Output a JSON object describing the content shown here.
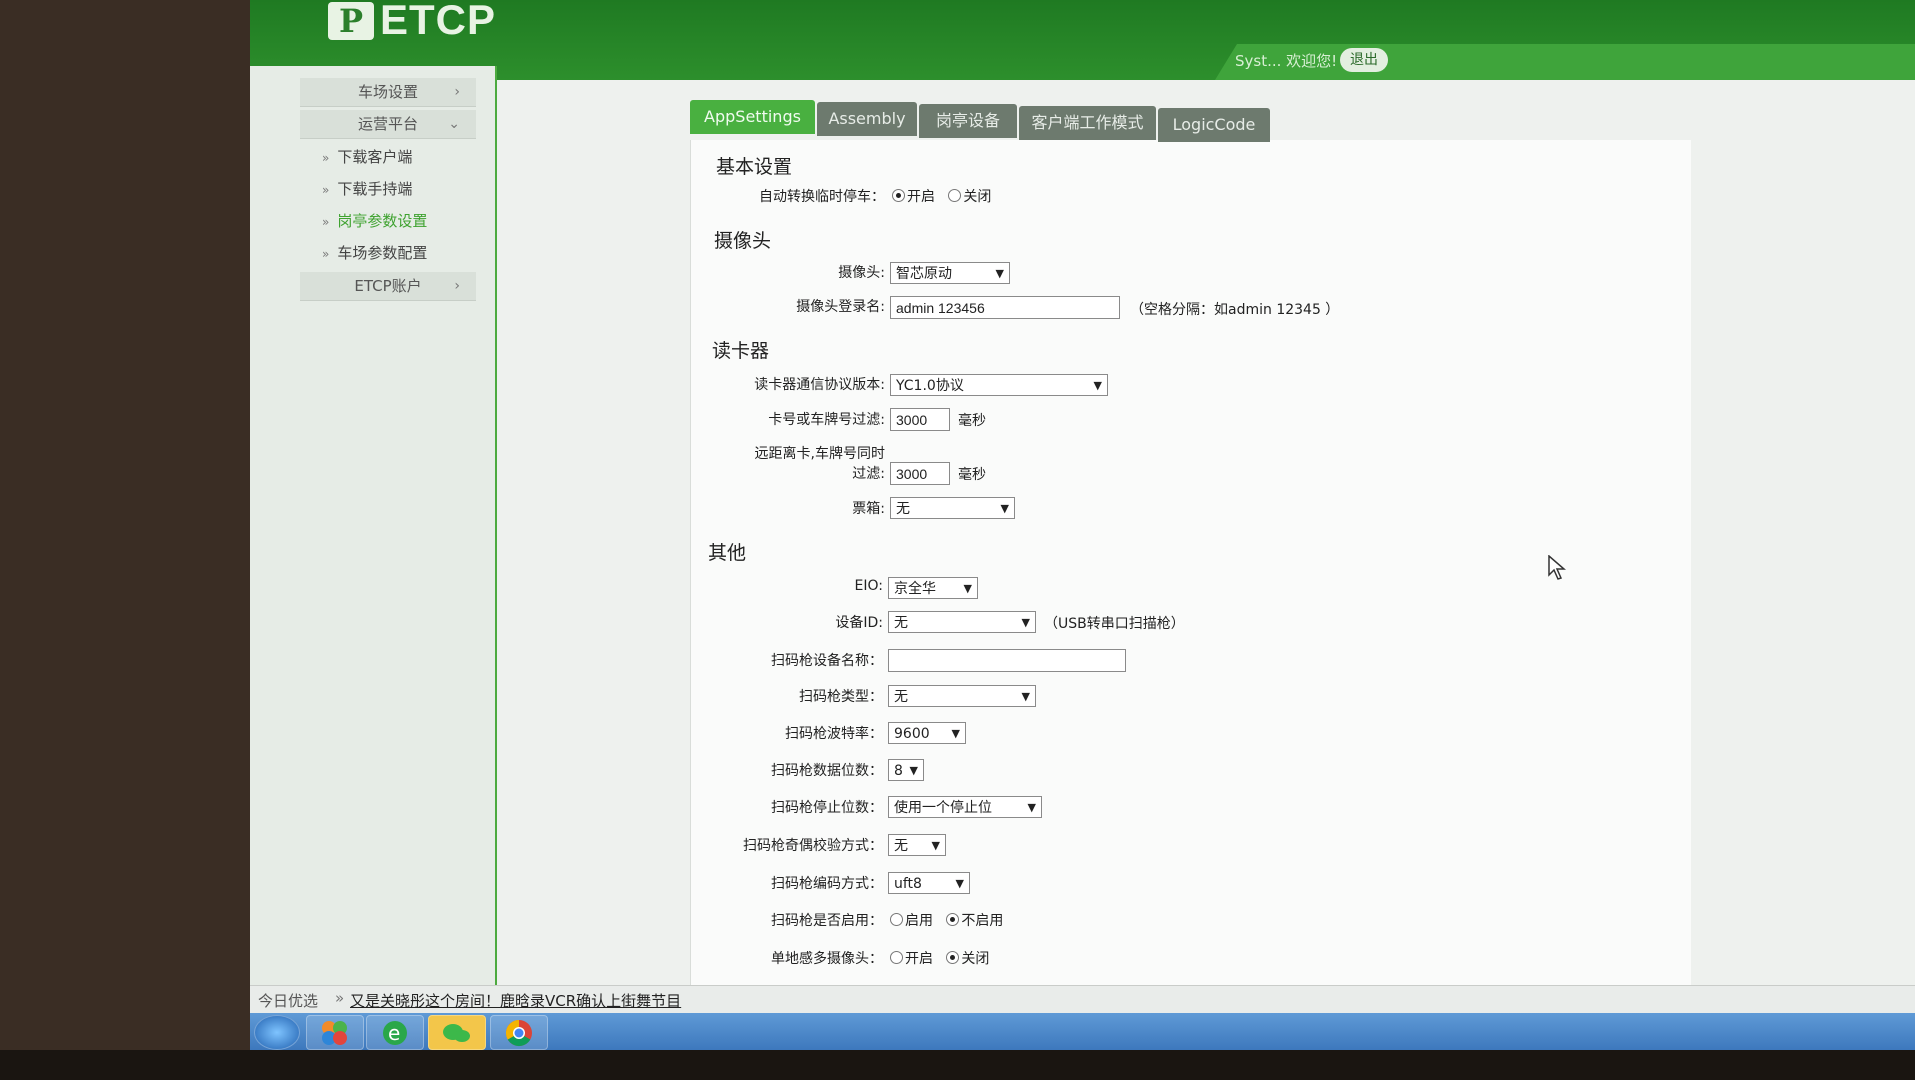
{
  "header": {
    "logo_mark": "P",
    "logo_text": "ETCP",
    "welcome": "Syst... 欢迎您!",
    "logout": "退出"
  },
  "sidebar": {
    "items": [
      {
        "label": "车场设置",
        "chevron": "›"
      },
      {
        "label": "运营平台",
        "chevron": "⌄"
      },
      {
        "label": "ETCP账户",
        "chevron": "›"
      }
    ],
    "subitems": [
      {
        "label": "下载客户端"
      },
      {
        "label": "下载手持端"
      },
      {
        "label": "岗亭参数设置"
      },
      {
        "label": "车场参数配置"
      }
    ]
  },
  "tabs": [
    "AppSettings",
    "Assembly",
    "岗亭设备",
    "客户端工作模式",
    "LogicCode"
  ],
  "sections": {
    "basic": "基本设置",
    "camera": "摄像头",
    "reader": "读卡器",
    "other": "其他"
  },
  "fields": {
    "auto_switch": {
      "label": "自动转换临时停车：",
      "opt_on": "开启",
      "opt_off": "关闭"
    },
    "camera": {
      "label": "摄像头:",
      "value": "智芯原动"
    },
    "camera_login": {
      "label": "摄像头登录名:",
      "value": "admin 123456",
      "note": "（空格分隔：如admin 12345 ）"
    },
    "reader_protocol": {
      "label": "读卡器通信协议版本:",
      "value": "YC1.0协议"
    },
    "card_filter": {
      "label": "卡号或车牌号过滤:",
      "value": "3000",
      "unit": "毫秒"
    },
    "remote_filter": {
      "label_line1": "远距离卡,车牌号同时",
      "label_line2": "过滤:",
      "value": "3000",
      "unit": "毫秒"
    },
    "ticket_box": {
      "label": "票箱:",
      "value": "无"
    },
    "eio": {
      "label": "EIO:",
      "value": "京全华"
    },
    "device_id": {
      "label": "设备ID:",
      "value": "无",
      "note": "（USB转串口扫描枪）"
    },
    "scanner_name": {
      "label": "扫码枪设备名称：",
      "value": ""
    },
    "scanner_type": {
      "label": "扫码枪类型：",
      "value": "无"
    },
    "scanner_baud": {
      "label": "扫码枪波特率：",
      "value": "9600"
    },
    "scanner_databits": {
      "label": "扫码枪数据位数：",
      "value": "8"
    },
    "scanner_stopbits": {
      "label": "扫码枪停止位数：",
      "value": "使用一个停止位"
    },
    "scanner_parity": {
      "label": "扫码枪奇偶校验方式：",
      "value": "无"
    },
    "scanner_encoding": {
      "label": "扫码枪编码方式：",
      "value": "uft8"
    },
    "scanner_enabled": {
      "label": "扫码枪是否启用：",
      "opt_on": "启用",
      "opt_off": "不启用"
    },
    "multi_camera": {
      "label": "单地感多摄像头：",
      "opt_on": "开启",
      "opt_off": "关闭"
    }
  },
  "newsbar": {
    "label": "今日优选",
    "chevron": "»",
    "headline": "又是关晓彤这个房间！鹿晗录VCR确认上街舞节目"
  }
}
